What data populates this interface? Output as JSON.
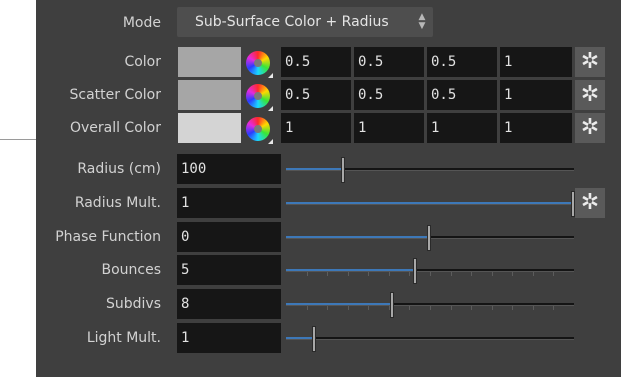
{
  "mode": {
    "label": "Mode",
    "value": "Sub-Surface Color + Radius"
  },
  "color_rows": [
    {
      "label": "Color",
      "swatch": "#a6a6a6",
      "values": [
        "0.5",
        "0.5",
        "0.5",
        "1"
      ]
    },
    {
      "label": "Scatter Color",
      "swatch": "#a6a6a6",
      "values": [
        "0.5",
        "0.5",
        "0.5",
        "1"
      ]
    },
    {
      "label": "Overall Color",
      "swatch": "#d4d4d4",
      "values": [
        "1",
        "1",
        "1",
        "1"
      ]
    }
  ],
  "slider_rows": [
    {
      "label": "Radius (cm)",
      "value": "100",
      "fraction": 0.2,
      "ticks": false,
      "gear": false
    },
    {
      "label": "Radius Mult.",
      "value": "1",
      "fraction": 1.0,
      "ticks": false,
      "gear": true
    },
    {
      "label": "Phase Function",
      "value": "0",
      "fraction": 0.5,
      "ticks": false,
      "gear": false
    },
    {
      "label": "Bounces",
      "value": "5",
      "fraction": 0.45,
      "ticks": true,
      "gear": false
    },
    {
      "label": "Subdivs",
      "value": "8",
      "fraction": 0.37,
      "ticks": true,
      "gear": false
    },
    {
      "label": "Light Mult.",
      "value": "1",
      "fraction": 0.1,
      "ticks": false,
      "gear": false
    }
  ],
  "icons": {
    "color_picker": "color-wheel-icon",
    "options": "gear-icon"
  },
  "colors": {
    "slider_fill": "#3d78b8",
    "panel": "#3f3f3f",
    "field": "#161616"
  }
}
